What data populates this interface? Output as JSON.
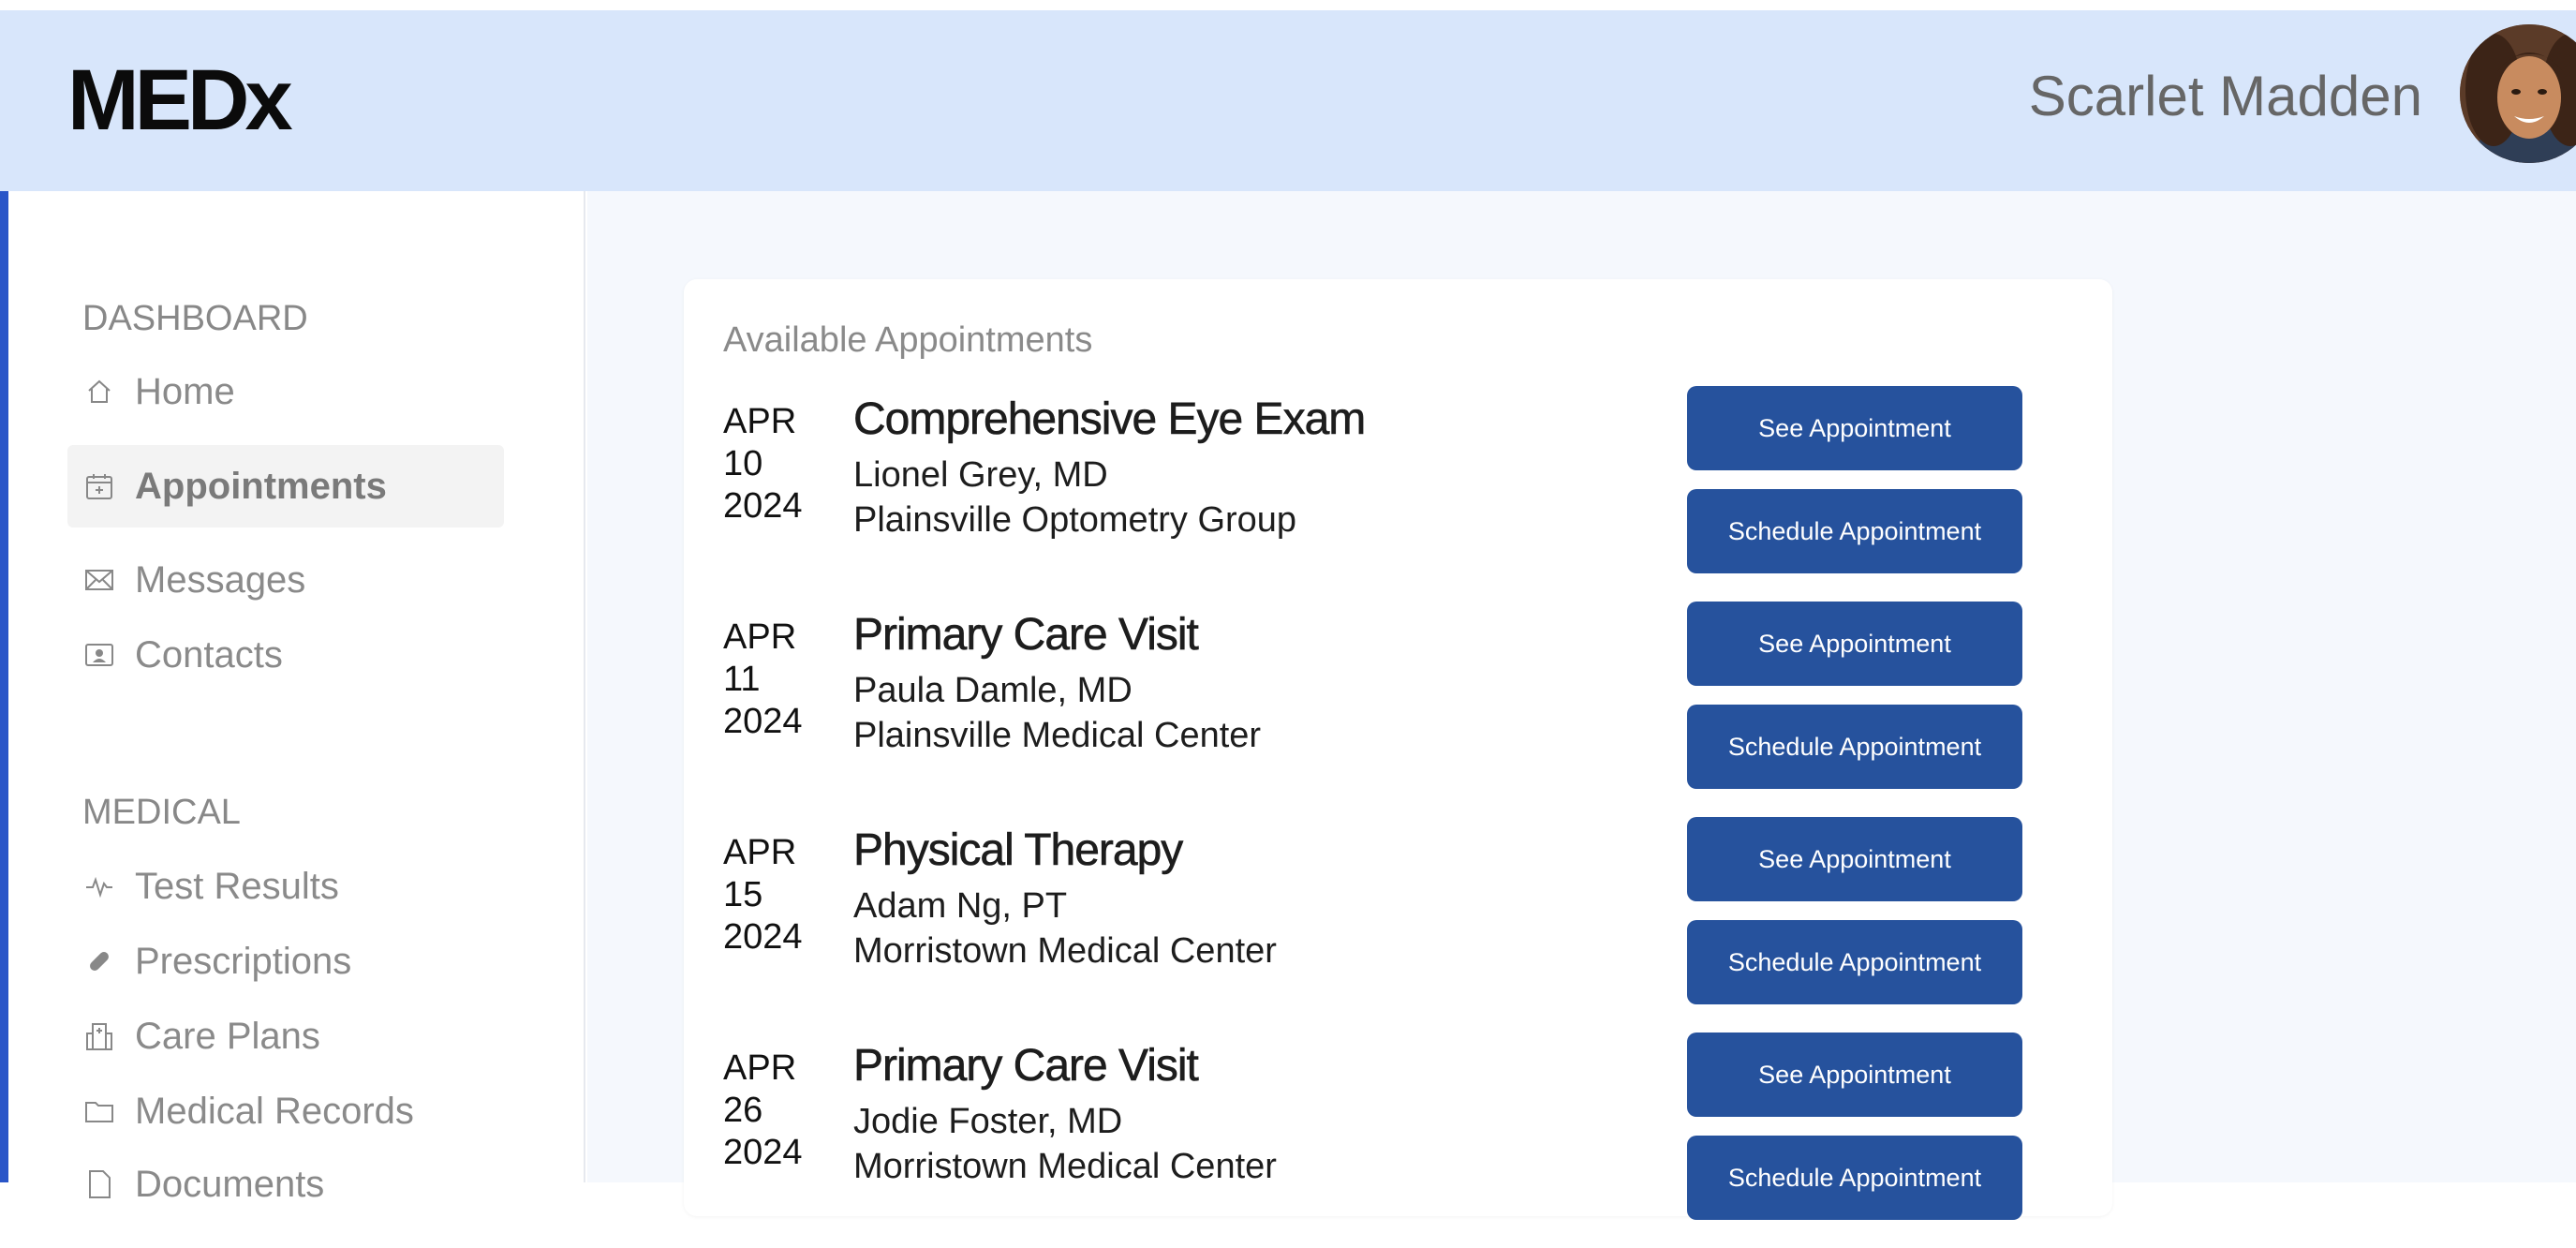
{
  "header": {
    "logo": "MEDx",
    "user_name": "Scarlet Madden"
  },
  "sidebar": {
    "sections": [
      {
        "label": "DASHBOARD",
        "items": [
          {
            "label": "Home",
            "icon": "home-icon"
          },
          {
            "label": "Appointments",
            "icon": "calendar-icon",
            "active": true
          },
          {
            "label": "Messages",
            "icon": "envelope-icon"
          },
          {
            "label": "Contacts",
            "icon": "contact-card-icon"
          }
        ]
      },
      {
        "label": "MEDICAL",
        "items": [
          {
            "label": "Test Results",
            "icon": "pulse-icon"
          },
          {
            "label": "Prescriptions",
            "icon": "pill-icon"
          },
          {
            "label": "Care Plans",
            "icon": "building-icon"
          },
          {
            "label": "Medical Records",
            "icon": "folder-icon"
          },
          {
            "label": "Documents",
            "icon": "document-icon"
          }
        ]
      }
    ]
  },
  "main": {
    "card_title": "Available Appointments",
    "see_label": "See Appointment",
    "schedule_label": "Schedule Appointment",
    "appointments": [
      {
        "month": "APR",
        "day": "10",
        "year": "2024",
        "title": "Comprehensive Eye Exam",
        "doctor": "Lionel Grey, MD",
        "place": "Plainsville Optometry Group"
      },
      {
        "month": "APR",
        "day": "11",
        "year": "2024",
        "title": "Primary Care Visit",
        "doctor": "Paula Damle, MD",
        "place": "Plainsville Medical Center"
      },
      {
        "month": "APR",
        "day": "15",
        "year": "2024",
        "title": "Physical Therapy",
        "doctor": "Adam Ng, PT",
        "place": "Morristown Medical Center"
      },
      {
        "month": "APR",
        "day": "26",
        "year": "2024",
        "title": "Primary Care Visit",
        "doctor": "Jodie Foster, MD",
        "place": "Morristown Medical Center"
      }
    ]
  },
  "colors": {
    "header_bg": "#d8e6fb",
    "accent": "#2955c8",
    "button_bg": "#26529d",
    "main_bg": "#f5f8fd"
  }
}
